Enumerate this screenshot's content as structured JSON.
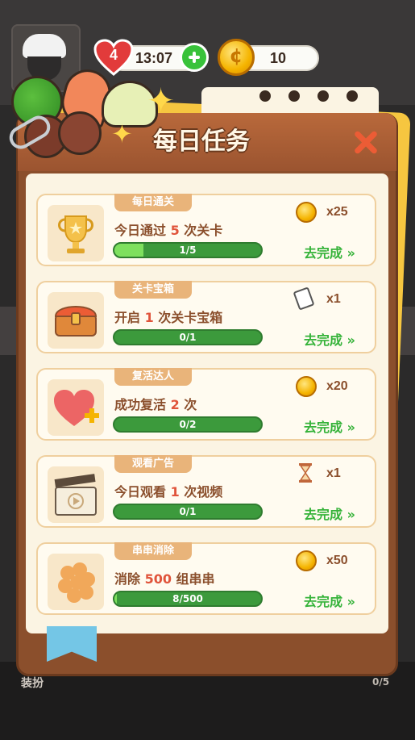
{
  "hud": {
    "lives": "4",
    "timer": "13:07",
    "coins": "10"
  },
  "dialog": {
    "title": "每日任务"
  },
  "tasks": [
    {
      "tag": "每日通关",
      "desc_pre": "今日通过 ",
      "desc_num": "5",
      "desc_post": " 次关卡",
      "progress_text": "1/5",
      "progress": 0.2,
      "reward_icon": "coin-icon",
      "reward_qty": "x25",
      "action": "去完成 »"
    },
    {
      "tag": "关卡宝箱",
      "desc_pre": "开启 ",
      "desc_num": "1",
      "desc_post": " 次关卡宝箱",
      "progress_text": "0/1",
      "progress": 0,
      "reward_icon": "paper-icon",
      "reward_qty": "x1",
      "action": "去完成 »"
    },
    {
      "tag": "复活达人",
      "desc_pre": "成功复活 ",
      "desc_num": "2",
      "desc_post": " 次",
      "progress_text": "0/2",
      "progress": 0,
      "reward_icon": "coin-icon",
      "reward_qty": "x20",
      "action": "去完成 »"
    },
    {
      "tag": "观看广告",
      "desc_pre": "今日观看 ",
      "desc_num": "1",
      "desc_post": " 次视频",
      "progress_text": "0/1",
      "progress": 0,
      "reward_icon": "hourglass-icon",
      "reward_qty": "x1",
      "action": "去完成 »"
    },
    {
      "tag": "串串消除",
      "desc_pre": "消除 ",
      "desc_num": "500",
      "desc_post": " 组串串",
      "progress_text": "8/500",
      "progress": 0.016,
      "reward_icon": "coin-icon",
      "reward_qty": "x50",
      "action": "去完成 »"
    }
  ],
  "bottom": {
    "left_label": "装扮",
    "right_label": "0/5"
  },
  "colors": {
    "panel": "#8b4f2c",
    "card_bg": "#fffbf0",
    "progress_green": "#3c9a3c",
    "action_green": "#36b33a",
    "close_red": "#ec5c35"
  }
}
